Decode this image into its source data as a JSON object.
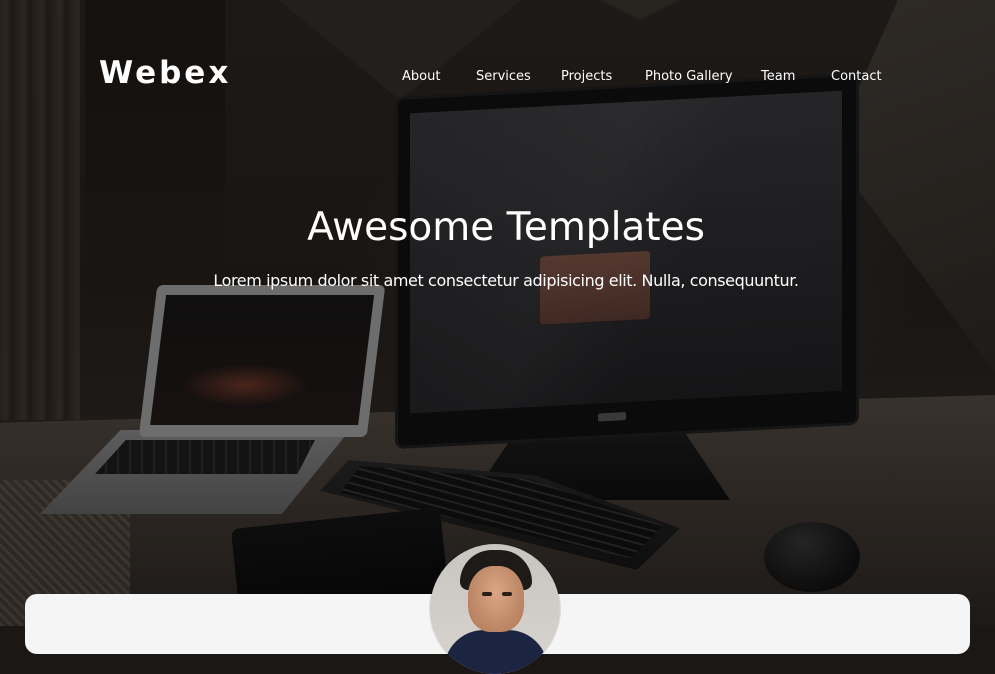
{
  "brand": {
    "name": "Webex"
  },
  "nav": {
    "items": [
      {
        "label": "About"
      },
      {
        "label": "Services"
      },
      {
        "label": "Projects"
      },
      {
        "label": "Photo Gallery"
      },
      {
        "label": "Team"
      },
      {
        "label": "Contact"
      }
    ]
  },
  "hero": {
    "title": "Awesome Templates",
    "subtitle": "Lorem ipsum dolor sit amet consectetur adipisicing elit. Nulla, consequuntur."
  },
  "icons": {
    "avatar": "profile-photo"
  },
  "colors": {
    "text": "#ffffff",
    "card": "#f5f5f5"
  }
}
